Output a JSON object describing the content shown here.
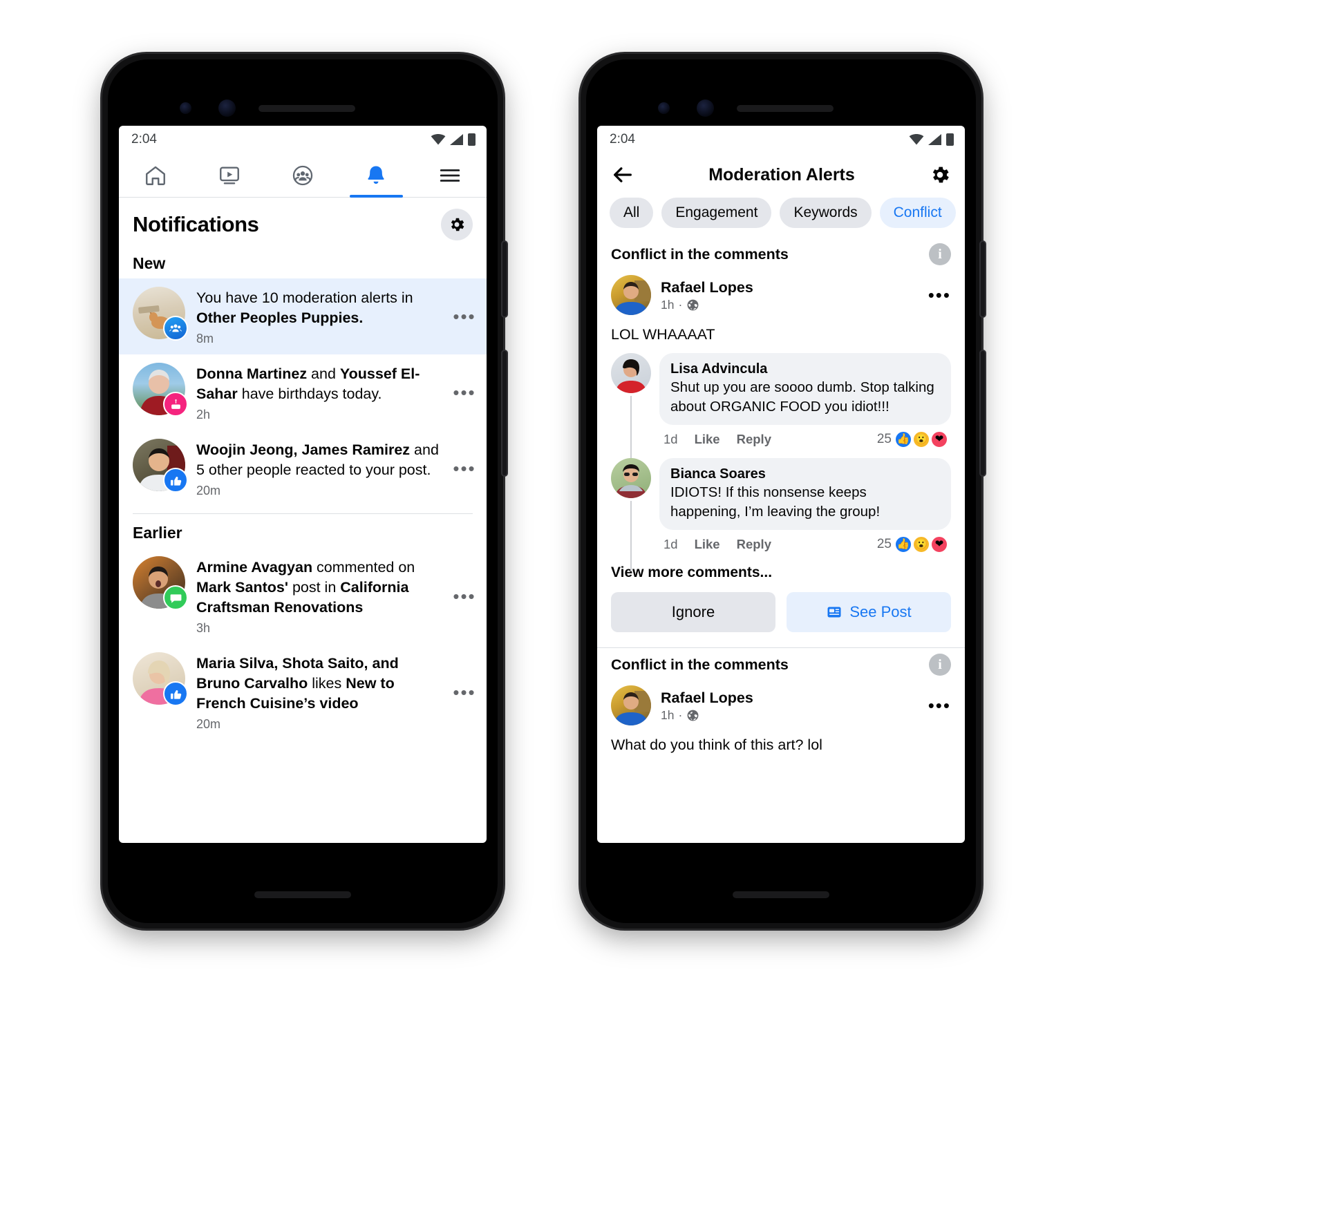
{
  "status_bar": {
    "time": "2:04",
    "icons": [
      "wifi-icon",
      "signal-icon",
      "battery-icon"
    ]
  },
  "colors": {
    "accent": "#1877f2",
    "unread_bg": "#e7f0fd",
    "chip_bg": "#e4e6eb",
    "bubble_bg": "#f0f2f5",
    "muted": "#65676b"
  },
  "left_phone": {
    "tabs": [
      {
        "name": "home",
        "icon": "home-icon",
        "active": false
      },
      {
        "name": "watch",
        "icon": "video-icon",
        "active": false
      },
      {
        "name": "groups",
        "icon": "groups-icon",
        "active": false
      },
      {
        "name": "notifications",
        "icon": "bell-icon",
        "active": true
      },
      {
        "name": "menu",
        "icon": "hamburger-menu-icon",
        "active": false
      }
    ],
    "header": {
      "title": "Notifications",
      "settings_icon": "gear-icon"
    },
    "sections": [
      {
        "title": "New",
        "items": [
          {
            "text_parts": [
              {
                "t": "You have 10 moderation alerts in ",
                "bold": false
              },
              {
                "t": "Other Peoples Puppies.",
                "bold": true
              }
            ],
            "time": "8m",
            "badge": "group-icon",
            "badge_color": "blue",
            "unread": true,
            "avatar": "dog-photo"
          },
          {
            "text_parts": [
              {
                "t": "Donna Martinez",
                "bold": true
              },
              {
                "t": " and ",
                "bold": false
              },
              {
                "t": "Youssef El-Sahar",
                "bold": true
              },
              {
                "t": " have birthdays today.",
                "bold": false
              }
            ],
            "time": "2h",
            "badge": "birthday-cake-icon",
            "badge_color": "pink",
            "unread": false,
            "avatar": "woman-red-sweater-photo"
          },
          {
            "text_parts": [
              {
                "t": "Woojin Jeong, James Ramirez",
                "bold": true
              },
              {
                "t": " and 5 other people reacted to your post.",
                "bold": false
              }
            ],
            "time": "20m",
            "badge": "thumbs-up-icon",
            "badge_color": "blue",
            "unread": false,
            "avatar": "man-white-hoodie-photo"
          }
        ]
      },
      {
        "title": "Earlier",
        "items": [
          {
            "text_parts": [
              {
                "t": "Armine Avagyan",
                "bold": true
              },
              {
                "t": " commented on ",
                "bold": false
              },
              {
                "t": "Mark Santos'",
                "bold": true
              },
              {
                "t": " post in ",
                "bold": false
              },
              {
                "t": "California Craftsman Renovations",
                "bold": true
              }
            ],
            "time": "3h",
            "badge": "comment-icon",
            "badge_color": "green",
            "unread": false,
            "avatar": "woman-laughing-photo"
          },
          {
            "text_parts": [
              {
                "t": "Maria Silva, Shota Saito, and Bruno Carvalho",
                "bold": true
              },
              {
                "t": " likes ",
                "bold": false
              },
              {
                "t": "New to French Cuisine’s video",
                "bold": true
              }
            ],
            "time": "20m",
            "badge": "thumbs-up-icon",
            "badge_color": "blue",
            "unread": false,
            "avatar": "woman-pink-shirt-photo"
          }
        ]
      }
    ],
    "overflow_label": "•••"
  },
  "right_phone": {
    "header": {
      "back_icon": "back-arrow-icon",
      "title": "Moderation Alerts",
      "settings_icon": "gear-icon"
    },
    "filter_chips": [
      {
        "label": "All",
        "active": false
      },
      {
        "label": "Engagement",
        "active": false
      },
      {
        "label": "Keywords",
        "active": false
      },
      {
        "label": "Conflict",
        "active": true
      }
    ],
    "alerts": [
      {
        "heading": "Conflict in the comments",
        "info_icon": "info-icon",
        "post": {
          "author": "Rafael Lopes",
          "time": "1h",
          "audience_icon": "globe-icon",
          "text": "LOL WHAAAAT",
          "overflow": "•••",
          "avatar": "man-blue-shirt-photo"
        },
        "comments": [
          {
            "author": "Lisa Advincula",
            "text": "Shut up you are soooo dumb. Stop talking about ORGANIC FOOD you idiot!!!",
            "time": "1d",
            "like_label": "Like",
            "reply_label": "Reply",
            "reaction_count": "25",
            "reactions": [
              "like",
              "wow",
              "love"
            ],
            "avatar": "woman-red-dress-photo"
          },
          {
            "author": "Bianca Soares",
            "text": "IDIOTS! If this nonsense keeps happening, I’m leaving the group!",
            "time": "1d",
            "like_label": "Like",
            "reply_label": "Reply",
            "reaction_count": "25",
            "reactions": [
              "like",
              "wow",
              "love"
            ],
            "avatar": "woman-sunglasses-photo"
          }
        ],
        "view_more": "View more comments...",
        "buttons": [
          {
            "label": "Ignore",
            "style": "secondary",
            "icon": null
          },
          {
            "label": "See Post",
            "style": "primary",
            "icon": "post-icon"
          }
        ]
      },
      {
        "heading": "Conflict in the comments",
        "info_icon": "info-icon",
        "post": {
          "author": "Rafael Lopes",
          "time": "1h",
          "audience_icon": "globe-icon",
          "text": "What do you think of this art? lol",
          "overflow": "•••",
          "avatar": "man-blue-shirt-photo"
        },
        "comments": [],
        "view_more": null,
        "buttons": []
      }
    ]
  }
}
